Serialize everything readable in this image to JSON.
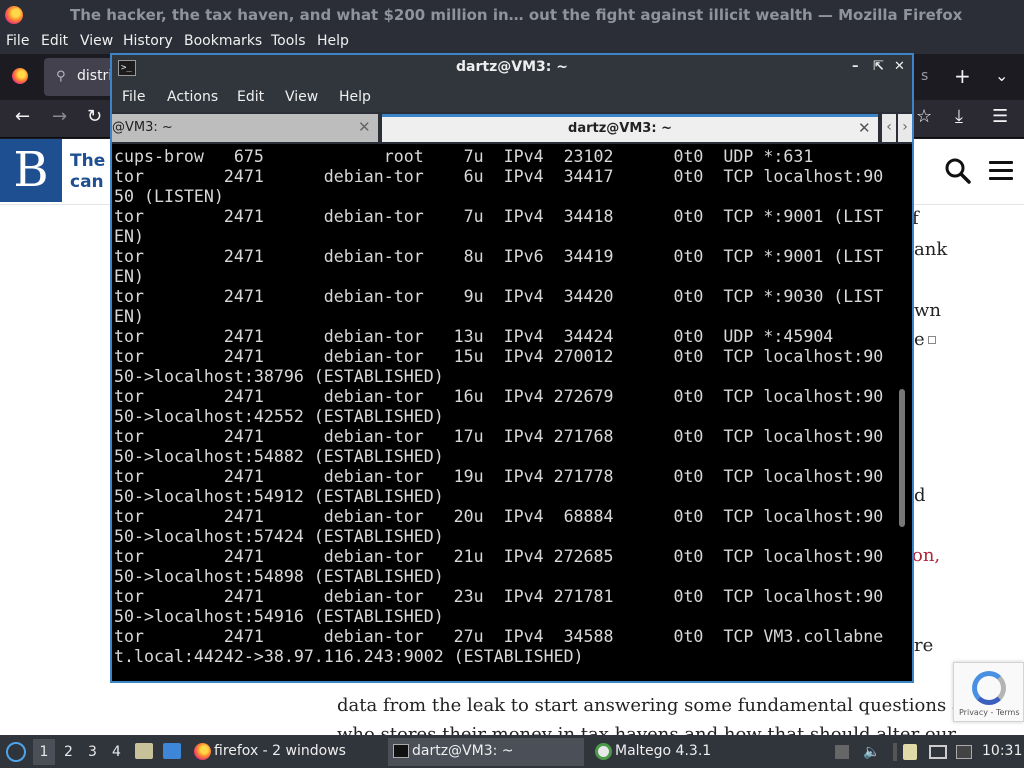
{
  "firefox": {
    "window_title": "The hacker, the tax haven, and what $200 million in… out the fight against illicit wealth — Mozilla Firefox",
    "menu": [
      "File",
      "Edit",
      "View",
      "History",
      "Bookmarks",
      "Tools",
      "Help"
    ],
    "tab_label": "distri",
    "tab_overflow_label": "s",
    "site_logo": "B",
    "site_name_line1": "The",
    "site_name_line2": "can",
    "fragments": {
      "f": "f",
      "ank": "ank",
      "wn": "wn",
      "e": "e",
      "d": "d",
      "on": "on,",
      "re": "re",
      "line1": "data from the leak to start answering some fundamental questions about",
      "line2": "who stores their money in tax havens and how that should alter our"
    },
    "recaptcha_links": "Privacy - Terms"
  },
  "terminal": {
    "window_title": "dartz@VM3: ~",
    "menu": [
      "File",
      "Actions",
      "Edit",
      "View",
      "Help"
    ],
    "tabs": [
      {
        "label": "@VM3: ~",
        "active": false
      },
      {
        "label": "dartz@VM3: ~",
        "active": true
      }
    ],
    "lines": [
      "cups-brow   675            root    7u  IPv4  23102      0t0  UDP *:631",
      "tor        2471      debian-tor    6u  IPv4  34417      0t0  TCP localhost:90",
      "50 (LISTEN)",
      "tor        2471      debian-tor    7u  IPv4  34418      0t0  TCP *:9001 (LIST",
      "EN)",
      "tor        2471      debian-tor    8u  IPv6  34419      0t0  TCP *:9001 (LIST",
      "EN)",
      "tor        2471      debian-tor    9u  IPv4  34420      0t0  TCP *:9030 (LIST",
      "EN)",
      "tor        2471      debian-tor   13u  IPv4  34424      0t0  UDP *:45904",
      "tor        2471      debian-tor   15u  IPv4 270012      0t0  TCP localhost:90",
      "50->localhost:38796 (ESTABLISHED)",
      "tor        2471      debian-tor   16u  IPv4 272679      0t0  TCP localhost:90",
      "50->localhost:42552 (ESTABLISHED)",
      "tor        2471      debian-tor   17u  IPv4 271768      0t0  TCP localhost:90",
      "50->localhost:54882 (ESTABLISHED)",
      "tor        2471      debian-tor   19u  IPv4 271778      0t0  TCP localhost:90",
      "50->localhost:54912 (ESTABLISHED)",
      "tor        2471      debian-tor   20u  IPv4  68884      0t0  TCP localhost:90",
      "50->localhost:57424 (ESTABLISHED)",
      "tor        2471      debian-tor   21u  IPv4 272685      0t0  TCP localhost:90",
      "50->localhost:54898 (ESTABLISHED)",
      "tor        2471      debian-tor   23u  IPv4 271781      0t0  TCP localhost:90",
      "50->localhost:54916 (ESTABLISHED)",
      "tor        2471      debian-tor   27u  IPv4  34588      0t0  TCP VM3.collabne",
      "t.local:44242->38.97.116.243:9002 (ESTABLISHED)"
    ]
  },
  "taskbar": {
    "workspaces": [
      "1",
      "2",
      "3",
      "4"
    ],
    "tasks": [
      {
        "label": "firefox - 2 windows",
        "icon": "firefox-icon"
      },
      {
        "label": "dartz@VM3: ~",
        "icon": "terminal-icon"
      },
      {
        "label": "Maltego 4.3.1",
        "icon": "maltego-icon"
      }
    ],
    "clock": "10:31"
  },
  "colors": {
    "accent": "#3c84c8",
    "site_brand": "#1d4f91",
    "link_red": "#b0263b",
    "terminal_bg": "#000000"
  }
}
